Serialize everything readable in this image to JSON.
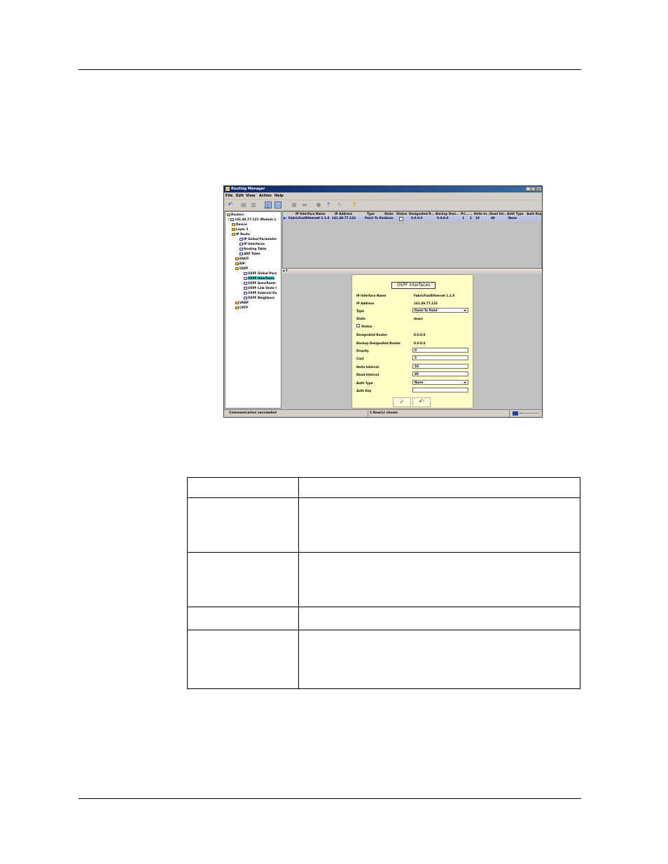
{
  "window": {
    "title": "Routing Manager",
    "controls": [
      "_",
      "□",
      "×"
    ]
  },
  "menu": [
    "File",
    "Edit",
    "View",
    "Action",
    "Help"
  ],
  "toolbar": {
    "icons": [
      "undo-icon",
      "copy-icon",
      "paste-icon",
      "details-icon",
      "graph-icon",
      "grid-icon",
      "table-icon",
      "circle-icon",
      "upload-icon",
      "tool-icon",
      "help-icon"
    ]
  },
  "tree": {
    "nodes": [
      {
        "label": "Routers",
        "icon": "folder"
      },
      {
        "label": "141.49.77.132 (Module 1",
        "icon": "router"
      },
      {
        "label": "Device",
        "icon": "folder"
      },
      {
        "label": "Layer 2",
        "icon": "folder"
      },
      {
        "label": "IP Route",
        "icon": "folder"
      },
      {
        "label": "IP Global Parameter",
        "icon": "doc"
      },
      {
        "label": "IP Interfaces",
        "icon": "doc"
      },
      {
        "label": "Routing Table",
        "icon": "doc"
      },
      {
        "label": "ARP Table",
        "icon": "doc"
      },
      {
        "label": "DHCP",
        "icon": "folder"
      },
      {
        "label": "RIP",
        "icon": "folder"
      },
      {
        "label": "OSPF",
        "icon": "folder"
      },
      {
        "label": "OSPF Global Para",
        "icon": "doc"
      },
      {
        "label": "OSPF Interfaces",
        "icon": "doc",
        "selected": true
      },
      {
        "label": "OSPF Area/Ranm",
        "icon": "doc"
      },
      {
        "label": "OSPF Link State I",
        "icon": "doc"
      },
      {
        "label": "OSPF External Da",
        "icon": "doc"
      },
      {
        "label": "OSPF Neighbors",
        "icon": "doc"
      },
      {
        "label": "VRRP",
        "icon": "folder"
      },
      {
        "label": "CRTP",
        "icon": "folder"
      }
    ]
  },
  "table": {
    "columns": [
      "IP Interface Name",
      "IP Address",
      "Type",
      "State",
      "Status",
      "Designated R...",
      "Backup Desi...",
      "Pri...",
      "...",
      "Hello In...",
      "Dead Int...",
      "Auth Type",
      "Auth Key"
    ],
    "rows": [
      [
        "FabricFastEthernet 1.1.0",
        "141.49.77.132",
        "Point To Point",
        "down",
        "",
        "0.0.0.0",
        "0.0.0.0",
        "1",
        "1",
        "10",
        "40",
        "None",
        ""
      ]
    ]
  },
  "dialog": {
    "title": "OSPF Interfaces",
    "fields": {
      "if_name_label": "IP Interface Name",
      "if_name": "FabricFastEthernet 1.1.0",
      "ip_label": "IP Address",
      "ip": "141.49.77.132",
      "type_label": "Type",
      "type": "Point To Point",
      "state_label": "State",
      "state": "down",
      "status_label": "Status",
      "dr_label": "Designated Router",
      "dr": "0.0.0.0",
      "bdr_label": "Backup Designated Router",
      "bdr": "0.0.0.0",
      "priority_label": "Priority",
      "priority": "0",
      "cost_label": "Cost",
      "cost": "5",
      "hello_label": "Hello Interval",
      "hello": "10",
      "dead_label": "Dead Interval",
      "dead": "40",
      "auth_type_label": "Auth Type",
      "auth_type": "None",
      "auth_key_label": "Auth Key",
      "auth_key": ""
    },
    "apply_icon": "✓",
    "revert_icon": "↶"
  },
  "status": {
    "left": "Communication succeeded",
    "middle": "1 Row(s) shown"
  }
}
